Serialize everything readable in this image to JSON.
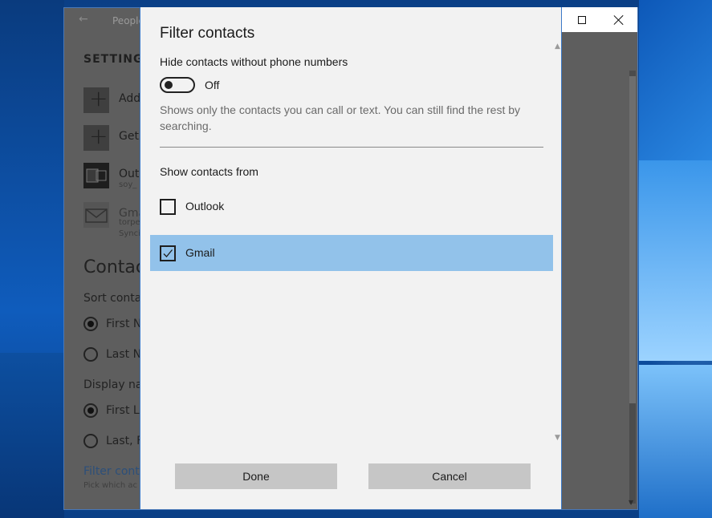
{
  "background_app": {
    "title": "People",
    "section_heading": "SETTING",
    "accounts": [
      {
        "label": "Add",
        "sub": ""
      },
      {
        "label": "Get",
        "sub": ""
      },
      {
        "label": "Out",
        "sub": "soy_"
      },
      {
        "label": "Gma",
        "sub": "torpe",
        "sub2": "Synci"
      }
    ],
    "contacts_heading": "Contac",
    "sort_label": "Sort conta",
    "sort_options": [
      "First N",
      "Last N"
    ],
    "display_label": "Display na",
    "display_options": [
      "First La",
      "Last, F"
    ],
    "filter_link": "Filter conta",
    "filter_sub": "Pick which ac"
  },
  "window": {
    "minimize_icon": "minimize-icon",
    "maximize_icon": "maximize-icon",
    "close_icon": "close-icon"
  },
  "dialog": {
    "title": "Filter contacts",
    "hide_label": "Hide contacts without phone numbers",
    "toggle_state": "Off",
    "description": "Shows only the contacts you can call or text. You can still find the rest by searching.",
    "show_from_label": "Show contacts from",
    "options": [
      {
        "label": "Outlook",
        "checked": false
      },
      {
        "label": "Gmail",
        "checked": true
      }
    ],
    "done_label": "Done",
    "cancel_label": "Cancel"
  },
  "colors": {
    "selected_row": "#92c2ea",
    "button_bg": "#c6c6c6",
    "dialog_bg": "#f2f2f2"
  }
}
